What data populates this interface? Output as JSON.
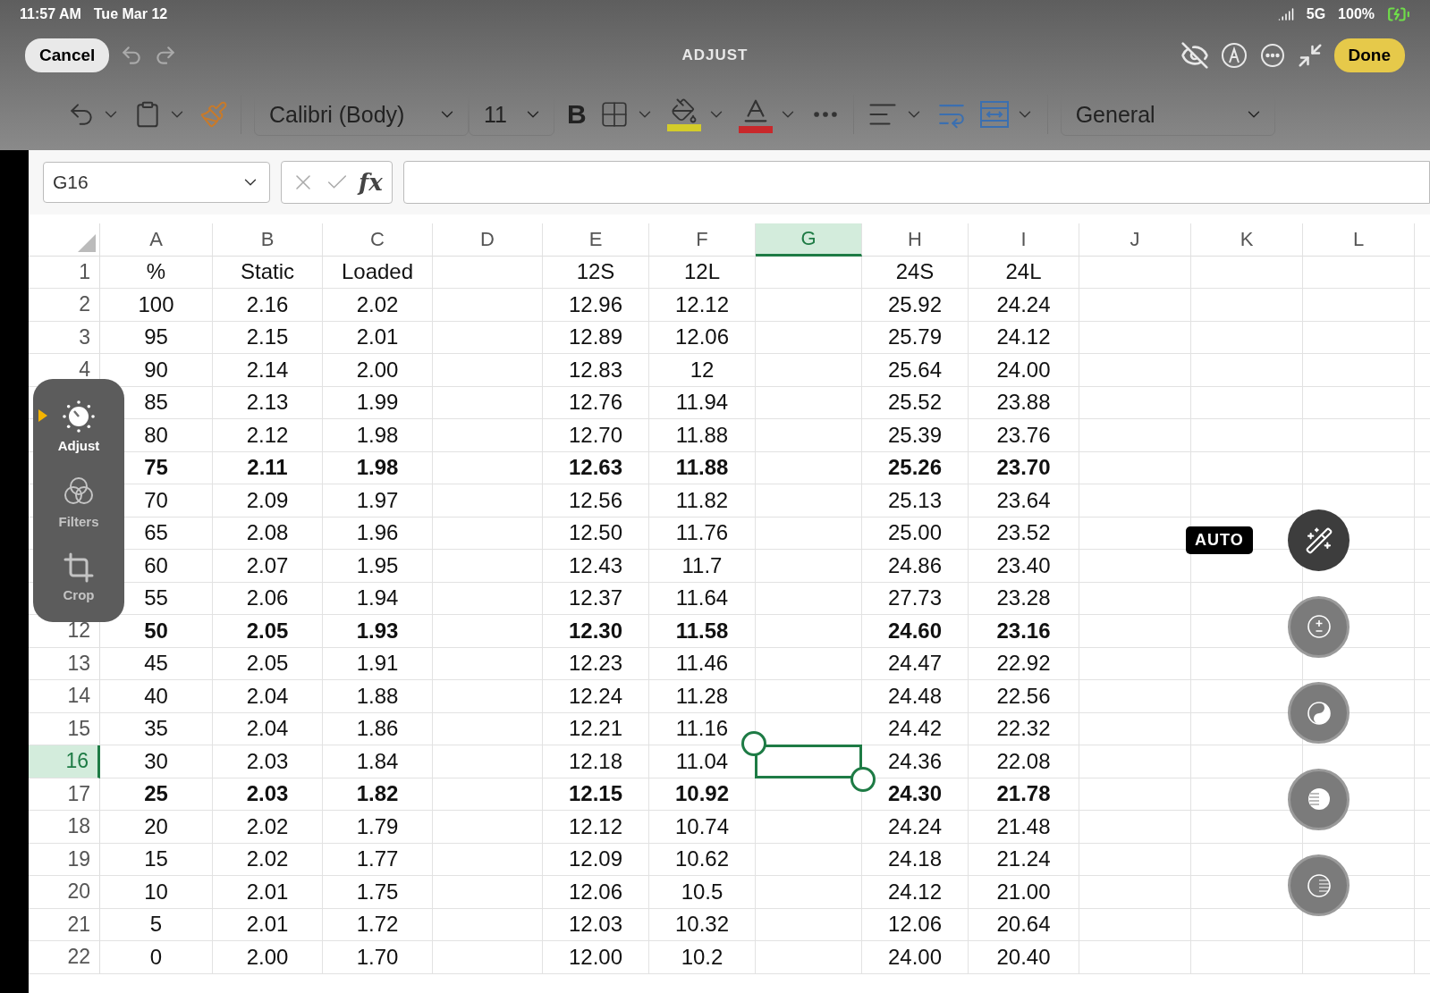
{
  "status_bar": {
    "time": "11:57 AM",
    "date": "Tue Mar 12",
    "network": "5G",
    "battery": "100%"
  },
  "editor": {
    "cancel": "Cancel",
    "title": "ADJUST",
    "done": "Done"
  },
  "toolbar": {
    "font": "Calibri (Body)",
    "size": "11",
    "bold": "B",
    "number_format": "General"
  },
  "formula_bar": {
    "name_box": "G16",
    "fx": "fx"
  },
  "sheet": {
    "columns": [
      {
        "label": "A",
        "selected": false
      },
      {
        "label": "B",
        "selected": false
      },
      {
        "label": "C",
        "selected": false
      },
      {
        "label": "D",
        "selected": false
      },
      {
        "label": "E",
        "selected": false
      },
      {
        "label": "F",
        "selected": false
      },
      {
        "label": "G",
        "selected": true
      },
      {
        "label": "H",
        "selected": false
      },
      {
        "label": "I",
        "selected": false
      },
      {
        "label": "J",
        "selected": false
      },
      {
        "label": "K",
        "selected": false
      },
      {
        "label": "L",
        "selected": false
      }
    ],
    "rows": [
      {
        "label": "1",
        "selected": false,
        "bold": false,
        "cells": [
          "%",
          "Static",
          "Loaded",
          null,
          "12S",
          "12L",
          null,
          "24S",
          "24L",
          null,
          null,
          null
        ]
      },
      {
        "label": "2",
        "selected": false,
        "bold": false,
        "cells": [
          "100",
          "2.16",
          "2.02",
          null,
          "12.96",
          "12.12",
          null,
          "25.92",
          "24.24",
          null,
          null,
          null
        ]
      },
      {
        "label": "3",
        "selected": false,
        "bold": false,
        "cells": [
          "95",
          "2.15",
          "2.01",
          null,
          "12.89",
          "12.06",
          null,
          "25.79",
          "24.12",
          null,
          null,
          null
        ]
      },
      {
        "label": "4",
        "selected": false,
        "bold": false,
        "cells": [
          "90",
          "2.14",
          "2.00",
          null,
          "12.83",
          "12",
          null,
          "25.64",
          "24.00",
          null,
          null,
          null
        ]
      },
      {
        "selected": false,
        "bold": false,
        "cells": [
          "85",
          "2.13",
          "1.99",
          null,
          "12.76",
          "11.94",
          null,
          "25.52",
          "23.88",
          null,
          null,
          null
        ]
      },
      {
        "selected": false,
        "bold": false,
        "cells": [
          "80",
          "2.12",
          "1.98",
          null,
          "12.70",
          "11.88",
          null,
          "25.39",
          "23.76",
          null,
          null,
          null
        ]
      },
      {
        "selected": false,
        "bold": true,
        "cells": [
          "75",
          "2.11",
          "1.98",
          null,
          "12.63",
          "11.88",
          null,
          "25.26",
          "23.70",
          null,
          null,
          null
        ]
      },
      {
        "selected": false,
        "bold": false,
        "cells": [
          "70",
          "2.09",
          "1.97",
          null,
          "12.56",
          "11.82",
          null,
          "25.13",
          "23.64",
          null,
          null,
          null
        ]
      },
      {
        "selected": false,
        "bold": false,
        "cells": [
          "65",
          "2.08",
          "1.96",
          null,
          "12.50",
          "11.76",
          null,
          "25.00",
          "23.52",
          null,
          null,
          null
        ]
      },
      {
        "selected": false,
        "bold": false,
        "cells": [
          "60",
          "2.07",
          "1.95",
          null,
          "12.43",
          "11.7",
          null,
          "24.86",
          "23.40",
          null,
          null,
          null
        ]
      },
      {
        "selected": false,
        "bold": false,
        "cells": [
          "55",
          "2.06",
          "1.94",
          null,
          "12.37",
          "11.64",
          null,
          "27.73",
          "23.28",
          null,
          null,
          null
        ]
      },
      {
        "label": "12",
        "selected": false,
        "bold": true,
        "cells": [
          "50",
          "2.05",
          "1.93",
          null,
          "12.30",
          "11.58",
          null,
          "24.60",
          "23.16",
          null,
          null,
          null
        ]
      },
      {
        "label": "13",
        "selected": false,
        "bold": false,
        "cells": [
          "45",
          "2.05",
          "1.91",
          null,
          "12.23",
          "11.46",
          null,
          "24.47",
          "22.92",
          null,
          null,
          null
        ]
      },
      {
        "label": "14",
        "selected": false,
        "bold": false,
        "cells": [
          "40",
          "2.04",
          "1.88",
          null,
          "12.24",
          "11.28",
          null,
          "24.48",
          "22.56",
          null,
          null,
          null
        ]
      },
      {
        "label": "15",
        "selected": false,
        "bold": false,
        "cells": [
          "35",
          "2.04",
          "1.86",
          null,
          "12.21",
          "11.16",
          null,
          "24.42",
          "22.32",
          null,
          null,
          null
        ]
      },
      {
        "label": "16",
        "selected": true,
        "bold": false,
        "cells": [
          "30",
          "2.03",
          "1.84",
          null,
          "12.18",
          "11.04",
          null,
          "24.36",
          "22.08",
          null,
          null,
          null
        ]
      },
      {
        "label": "17",
        "selected": false,
        "bold": true,
        "cells": [
          "25",
          "2.03",
          "1.82",
          null,
          "12.15",
          "10.92",
          null,
          "24.30",
          "21.78",
          null,
          null,
          null
        ]
      },
      {
        "label": "18",
        "selected": false,
        "bold": false,
        "cells": [
          "20",
          "2.02",
          "1.79",
          null,
          "12.12",
          "10.74",
          null,
          "24.24",
          "21.48",
          null,
          null,
          null
        ]
      },
      {
        "label": "19",
        "selected": false,
        "bold": false,
        "cells": [
          "15",
          "2.02",
          "1.77",
          null,
          "12.09",
          "10.62",
          null,
          "24.18",
          "21.24",
          null,
          null,
          null
        ]
      },
      {
        "label": "20",
        "selected": false,
        "bold": false,
        "cells": [
          "10",
          "2.01",
          "1.75",
          null,
          "12.06",
          "10.5",
          null,
          "24.12",
          "21.00",
          null,
          null,
          null
        ]
      },
      {
        "label": "21",
        "selected": false,
        "bold": false,
        "cells": [
          "5",
          "2.01",
          "1.72",
          null,
          "12.03",
          "10.32",
          null,
          "12.06",
          "20.64",
          null,
          null,
          null
        ]
      },
      {
        "label": "22",
        "selected": false,
        "bold": false,
        "cells": [
          "0",
          "2.00",
          "1.70",
          null,
          "12.00",
          "10.2",
          null,
          "24.00",
          "20.40",
          null,
          null,
          null
        ]
      }
    ]
  },
  "edit_tools": [
    {
      "kind": "adjust",
      "label": "Adjust",
      "selected": true
    },
    {
      "kind": "filters",
      "label": "Filters",
      "selected": false
    },
    {
      "kind": "crop",
      "label": "Crop",
      "selected": false
    }
  ],
  "auto_label": "AUTO",
  "dials": [
    {
      "kind": "auto",
      "selected": true
    },
    {
      "kind": "exposure",
      "selected": false
    },
    {
      "kind": "brilliance",
      "selected": false
    },
    {
      "kind": "highlights",
      "selected": false
    },
    {
      "kind": "shadows",
      "selected": false
    }
  ]
}
